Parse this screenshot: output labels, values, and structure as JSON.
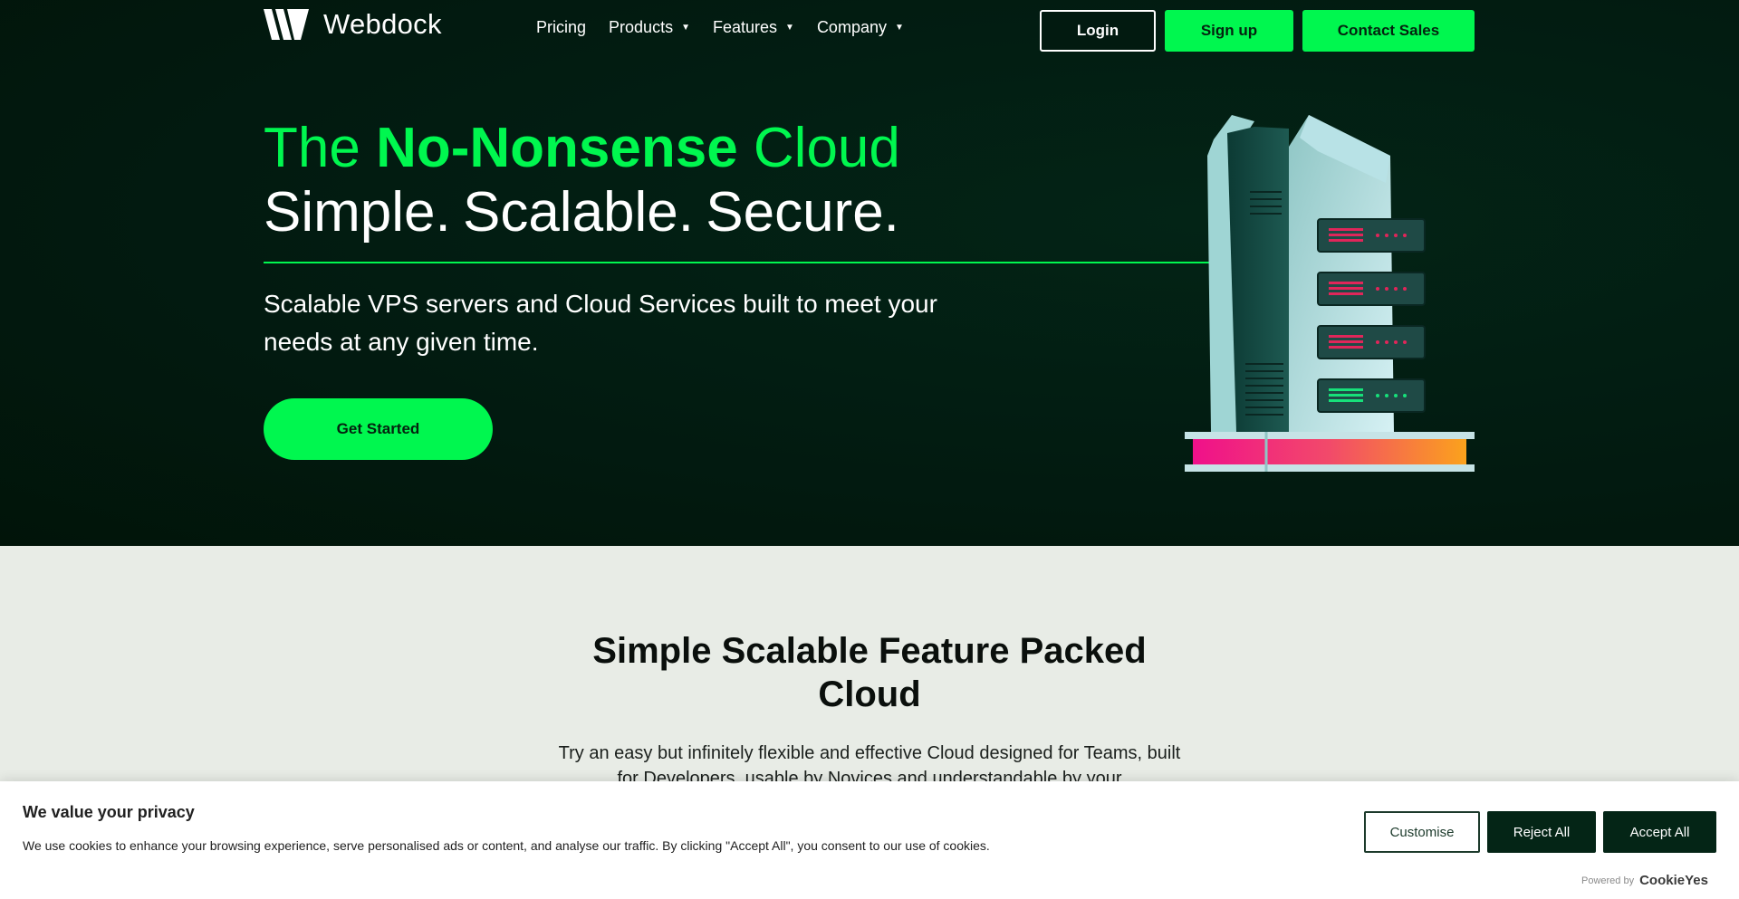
{
  "brand": {
    "name": "Webdock",
    "accent": "#00f74f",
    "background": "#021a10"
  },
  "nav": {
    "items": [
      {
        "label": "Pricing",
        "has_dropdown": false
      },
      {
        "label": "Products",
        "has_dropdown": true
      },
      {
        "label": "Features",
        "has_dropdown": true
      },
      {
        "label": "Company",
        "has_dropdown": true
      }
    ],
    "caret": "▼"
  },
  "header_buttons": {
    "login": "Login",
    "signup": "Sign up",
    "contact": "Contact Sales"
  },
  "hero": {
    "headline_pre": "The ",
    "headline_bold": "No-Nonsense",
    "headline_post": " Cloud",
    "headline_line2": "Simple. Scalable. Secure.",
    "subtitle": "Scalable VPS servers and Cloud Services built to meet your needs at any given time.",
    "cta": "Get Started",
    "illustration": "server-tower-icon"
  },
  "section": {
    "title": "Simple Scalable Feature Packed Cloud",
    "text": "Try an easy but infinitely flexible and effective Cloud designed for Teams, built for Developers, usable by Novices and understandable by your"
  },
  "cookie_banner": {
    "title": "We value your privacy",
    "text": "We use cookies to enhance your browsing experience, serve personalised ads or content, and analyse our traffic. By clicking \"Accept All\", you consent to our use of cookies.",
    "customise": "Customise",
    "reject": "Reject All",
    "accept": "Accept All",
    "powered_label": "Powered by",
    "powered_brand": "CookieYes"
  }
}
